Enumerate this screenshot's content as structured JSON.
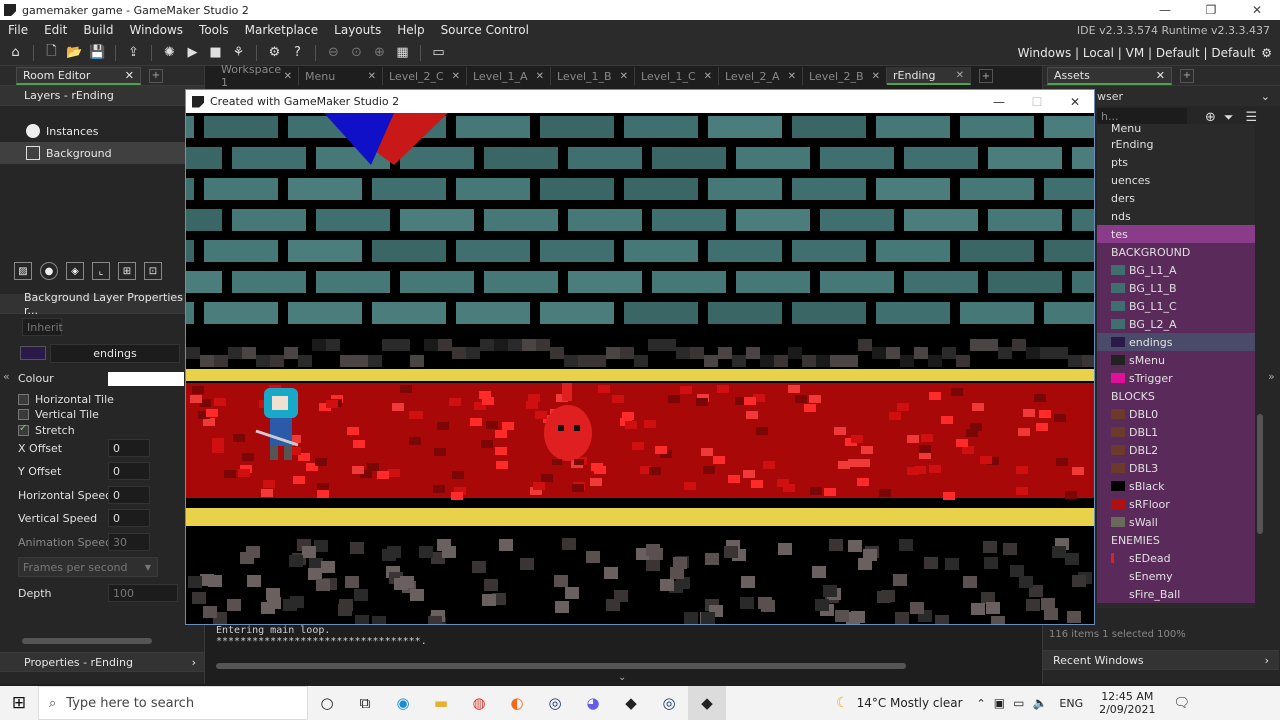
{
  "window": {
    "title": "gamemaker game - GameMaker Studio 2"
  },
  "menu": [
    "File",
    "Edit",
    "Build",
    "Windows",
    "Tools",
    "Marketplace",
    "Layouts",
    "Help",
    "Source Control"
  ],
  "version": "IDE v2.3.3.574  Runtime v2.3.3.437",
  "target": "Windows | Local | VM | Default | Default",
  "left_panel": {
    "tab": "Room Editor",
    "layers_title": "Layers - rEnding",
    "layers": [
      {
        "name": "Instances"
      },
      {
        "name": "Background"
      }
    ],
    "props_title": "Background Layer Properties - r...",
    "inherit": "Inherit",
    "sprite": "endings",
    "colour_label": "Colour",
    "htile": "Horizontal Tile",
    "vtile": "Vertical Tile",
    "stretch": "Stretch",
    "xoffset": {
      "label": "X Offset",
      "value": "0"
    },
    "yoffset": {
      "label": "Y Offset",
      "value": "0"
    },
    "hspeed": {
      "label": "Horizontal Speed",
      "value": "0"
    },
    "vspeed": {
      "label": "Vertical Speed",
      "value": "0"
    },
    "anim": {
      "label": "Animation Speed:",
      "value": "30"
    },
    "fps": "Frames per second",
    "depth": {
      "label": "Depth",
      "value": "100"
    },
    "properties": "Properties - rEnding"
  },
  "center_tabs": [
    {
      "label": "Workspace 1"
    },
    {
      "label": "Menu"
    },
    {
      "label": "Level_2_C"
    },
    {
      "label": "Level_1_A"
    },
    {
      "label": "Level_1_B"
    },
    {
      "label": "Level_1_C"
    },
    {
      "label": "Level_2_A"
    },
    {
      "label": "Level_2_B"
    },
    {
      "label": "rEnding"
    }
  ],
  "right_panel": {
    "tab": "Assets",
    "browser": "wser",
    "search": "h...",
    "items": [
      {
        "label": "Menu"
      },
      {
        "label": "rEnding"
      },
      {
        "label": "pts"
      },
      {
        "label": "uences"
      },
      {
        "label": "ders"
      },
      {
        "label": "nds"
      },
      {
        "label": "tes"
      },
      {
        "label": "BACKGROUND"
      },
      {
        "label": "BG_L1_A"
      },
      {
        "label": "BG_L1_B"
      },
      {
        "label": "BG_L1_C"
      },
      {
        "label": "BG_L2_A"
      },
      {
        "label": "endings"
      },
      {
        "label": "sMenu"
      },
      {
        "label": "sTrigger"
      },
      {
        "label": "BLOCKS"
      },
      {
        "label": "DBL0"
      },
      {
        "label": "DBL1"
      },
      {
        "label": "DBL2"
      },
      {
        "label": "DBL3"
      },
      {
        "label": "sBlack"
      },
      {
        "label": "sRFloor"
      },
      {
        "label": "sWall"
      },
      {
        "label": "ENEMIES"
      },
      {
        "label": "sEDead"
      },
      {
        "label": "sEnemy"
      },
      {
        "label": "sFire_Ball"
      }
    ],
    "count": "116 items   1 selected  100%",
    "recent": "Recent Windows"
  },
  "game_window": {
    "title": "Created with GameMaker Studio 2"
  },
  "output": {
    "line1": "Entering main loop.",
    "line2": "**********************************."
  },
  "taskbar": {
    "search": "Type here to search",
    "weather": "14°C  Mostly clear",
    "lang": "ENG",
    "time": "12:45 AM",
    "date": "2/09/2021"
  },
  "colors": {
    "accent_green": "#4ea34e",
    "highlight_purple": "#8a3c8a",
    "brick": "#3f6f6f",
    "lava": "#c40a0a",
    "gold": "#e8d24a"
  }
}
